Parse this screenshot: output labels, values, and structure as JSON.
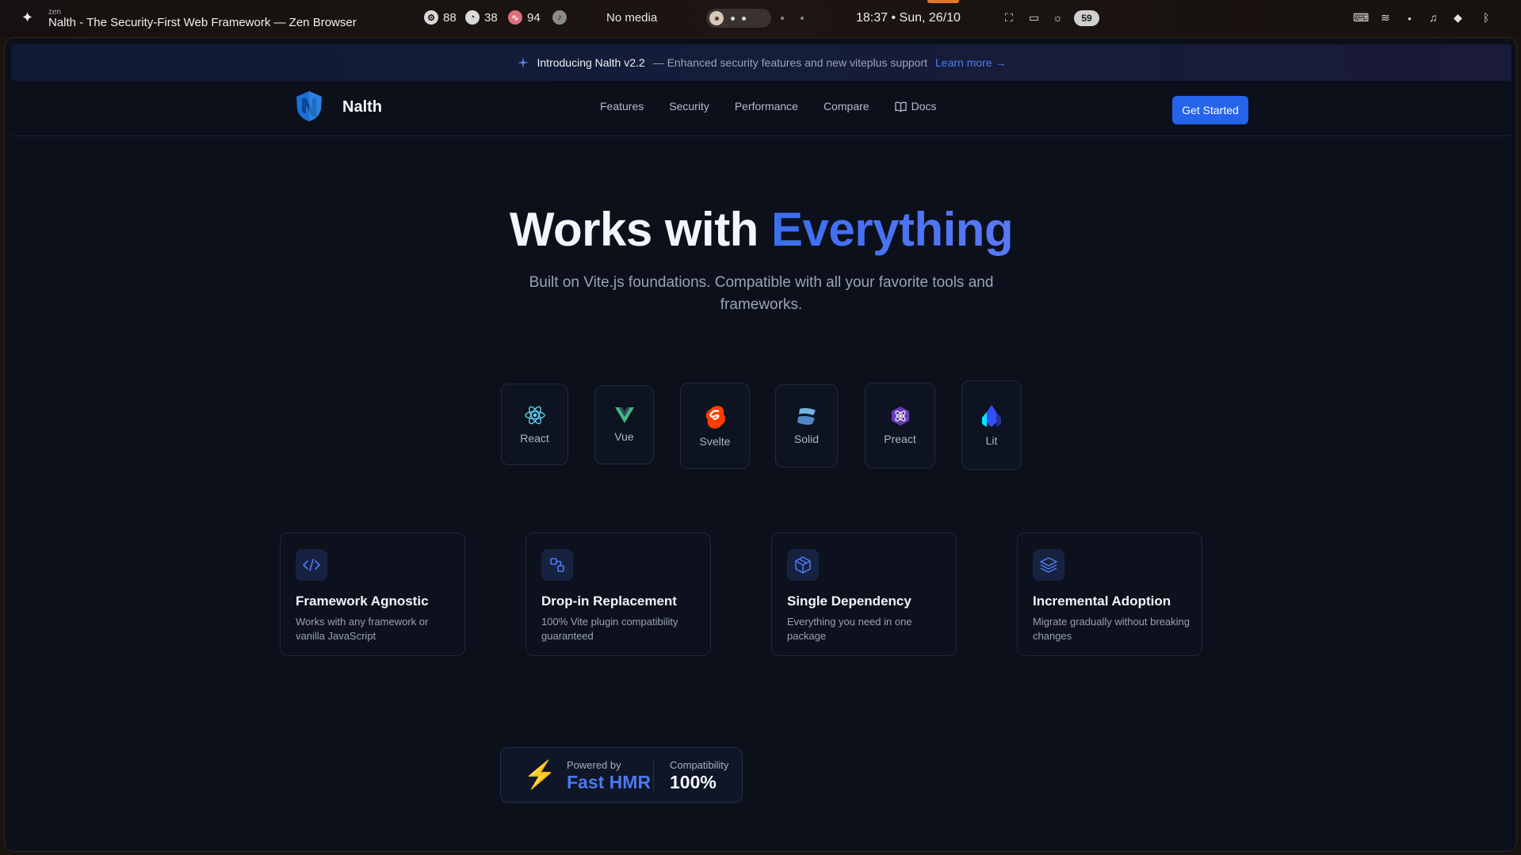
{
  "system_bar": {
    "app_name": "zen",
    "window_title": "Nalth - The Security-First Web Framework — Zen Browser",
    "stats": [
      {
        "icon": "cpu-icon",
        "value": "88"
      },
      {
        "icon": "memory-icon",
        "value": "38"
      },
      {
        "icon": "activity-icon",
        "value": "94"
      }
    ],
    "media_text": "No media",
    "clock": "18:37 • Sun, 26/10",
    "notification_count": "59",
    "accent_color": "#e0762a"
  },
  "announcement": {
    "intro": "Introducing Nalth v2.2",
    "description": "— Enhanced security features and new viteplus support",
    "link": "Learn more →"
  },
  "nav": {
    "brand": "Nalth",
    "links": [
      "Features",
      "Security",
      "Performance",
      "Compare",
      "Docs"
    ],
    "cta": "Get Started",
    "accent_color": "#2563eb"
  },
  "hero": {
    "title_plain": "Works with ",
    "title_accent": "Everything",
    "subtitle": "Built on Vite.js foundations. Compatible with all your favorite tools and frameworks."
  },
  "frameworks": [
    {
      "name": "React",
      "icon": "react-icon",
      "color": "#5fd3f3"
    },
    {
      "name": "Vue",
      "icon": "vue-icon",
      "color": "#42b883"
    },
    {
      "name": "Svelte",
      "icon": "svelte-icon",
      "color": "#ff3e00"
    },
    {
      "name": "Solid",
      "icon": "solid-icon",
      "color": "#4f88c6"
    },
    {
      "name": "Preact",
      "icon": "preact-icon",
      "color": "#673ab8"
    },
    {
      "name": "Lit",
      "icon": "lit-icon",
      "color": "#324fff"
    }
  ],
  "features": [
    {
      "icon": "code-icon",
      "title": "Framework Agnostic",
      "description": "Works with any framework or vanilla JavaScript"
    },
    {
      "icon": "replace-icon",
      "title": "Drop-in Replacement",
      "description": "100% Vite plugin compatibility guaranteed"
    },
    {
      "icon": "package-icon",
      "title": "Single Dependency",
      "description": "Everything you need in one package"
    },
    {
      "icon": "layers-icon",
      "title": "Incremental Adoption",
      "description": "Migrate gradually without breaking changes"
    }
  ],
  "powered": {
    "label": "Powered by",
    "value": "Fast HMR",
    "compat_label": "Compatibility",
    "compat_value": "100%"
  }
}
